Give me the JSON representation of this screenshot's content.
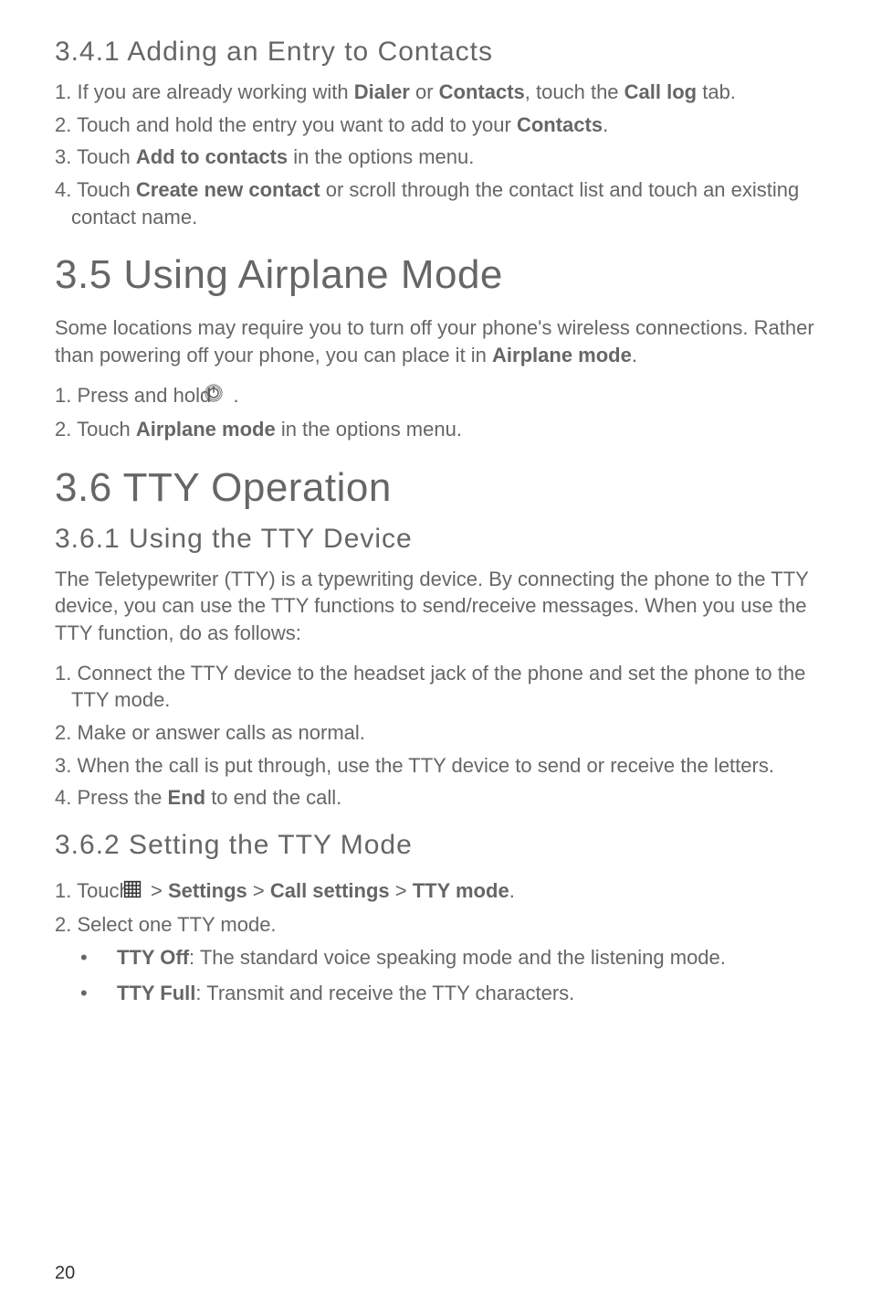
{
  "s341": {
    "heading": "3.4.1  Adding  an  Entry  to  Contacts",
    "items": {
      "0": {
        "pre": "1. If you are already working with ",
        "b1": "Dialer",
        "mid1": " or ",
        "b2": "Contacts",
        "mid2": ", touch the ",
        "b3": "Call log",
        "post": " tab."
      },
      "1": {
        "pre": "2. Touch and hold the entry you want to add to your ",
        "b1": "Contacts",
        "post": "."
      },
      "2": {
        "pre": "3. Touch ",
        "b1": "Add to contacts",
        "post": " in the options menu."
      },
      "3": {
        "pre": "4. Touch ",
        "b1": "Create new contact",
        "post": " or scroll through the contact list and touch an existing contact name."
      }
    }
  },
  "s35": {
    "heading": "3.5  Using Airplane Mode",
    "para_pre": "Some locations may require you to turn off your phone's wireless connections. Rather than powering off your phone, you can place it in ",
    "para_bold": "Airplane mode",
    "para_post": ".",
    "items": {
      "0": {
        "pre": "1. Press and hold  ",
        "post": " ."
      },
      "1": {
        "pre": "2. Touch ",
        "b1": "Airplane mode",
        "post": " in the options menu."
      }
    }
  },
  "s36": {
    "heading": "3.6  TTY Operation"
  },
  "s361": {
    "heading": "3.6.1  Using  the  TTY  Device",
    "para": "The Teletypewriter (TTY) is a typewriting device. By connecting the phone to the TTY device, you can use the TTY functions to send/receive messages. When you use the TTY function, do as follows:",
    "items": {
      "0": "1. Connect the TTY device to the headset jack of the phone and set the phone to the TTY mode.",
      "1": "2. Make or answer calls as normal.",
      "2": "3. When the call is put through, use the TTY device to send or receive the letters.",
      "3": {
        "pre": "4. Press the ",
        "b1": "End",
        "post": " to end the call."
      }
    }
  },
  "s362": {
    "heading": "3.6.2  Setting  the  TTY  Mode",
    "items": {
      "0": {
        "pre": "1. Touch  ",
        "mid": "  > ",
        "b1": "Settings",
        "sep1": " > ",
        "b2": "Call settings",
        "sep2": " > ",
        "b3": "TTY mode",
        "post": "."
      },
      "1": "2. Select one TTY mode.",
      "bullets": {
        "0": {
          "b": "TTY Off",
          "t": ": The standard voice speaking mode and the listening mode."
        },
        "1": {
          "b": "TTY Full",
          "t": ": Transmit and receive the TTY characters."
        }
      }
    }
  },
  "page_number": "20"
}
